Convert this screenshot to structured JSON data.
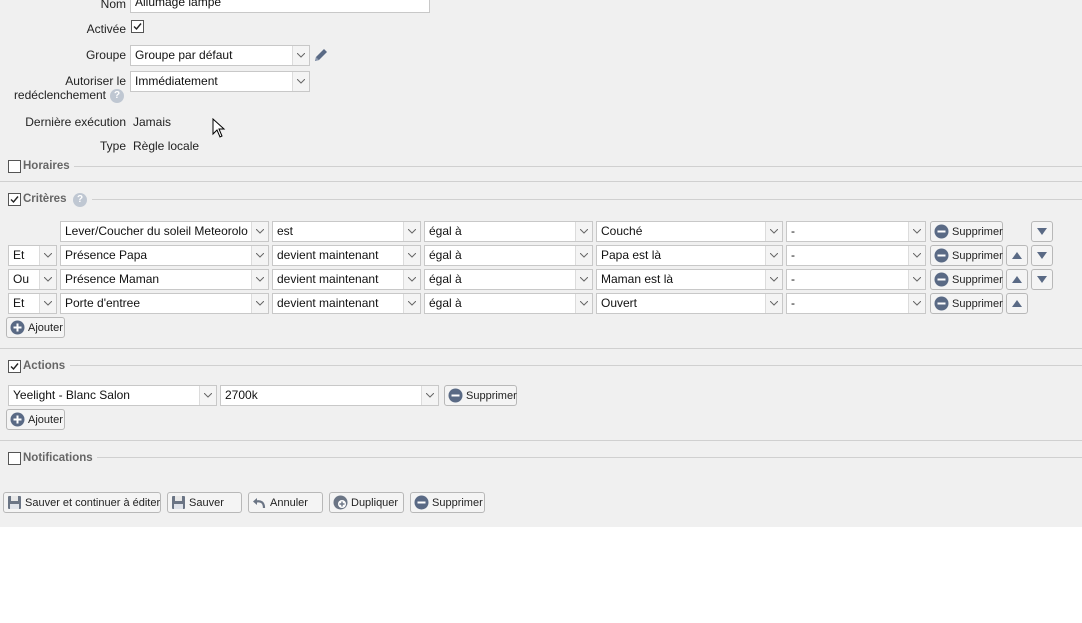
{
  "general": {
    "nom_label": "Nom",
    "nom_value": "Allumage lampe",
    "activee_label": "Activée",
    "groupe_label": "Groupe",
    "groupe_value": "Groupe par défaut",
    "autoriser_label_1": "Autoriser le",
    "autoriser_label_2": "redéclenchement",
    "autoriser_value": "Immédiatement",
    "derniere_label": "Dernière exécution",
    "derniere_value": "Jamais",
    "type_label": "Type",
    "type_value": "Règle locale"
  },
  "sections": {
    "horaires": "Horaires",
    "criteres": "Critères",
    "actions": "Actions",
    "notifications": "Notifications"
  },
  "criteria": {
    "rows": [
      {
        "conn": "",
        "subject": "Lever/Coucher du soleil Meteorolo",
        "verb": "est",
        "op": "égal à",
        "value": "Couché",
        "extra": "-",
        "delete": "Supprimer"
      },
      {
        "conn": "Et",
        "subject": "Présence Papa",
        "verb": "devient maintenant",
        "op": "égal à",
        "value": "Papa est là",
        "extra": "-",
        "delete": "Supprimer"
      },
      {
        "conn": "Ou",
        "subject": "Présence Maman",
        "verb": "devient maintenant",
        "op": "égal à",
        "value": "Maman est là",
        "extra": "-",
        "delete": "Supprimer"
      },
      {
        "conn": "Et",
        "subject": "Porte d'entree",
        "verb": "devient maintenant",
        "op": "égal à",
        "value": "Ouvert",
        "extra": "-",
        "delete": "Supprimer"
      }
    ],
    "add_label": "Ajouter"
  },
  "actions": {
    "device": "Yeelight - Blanc Salon",
    "value": "2700k",
    "delete_label": "Supprimer",
    "add_label": "Ajouter"
  },
  "footer": {
    "save_continue": "Sauver et continuer à éditer",
    "save": "Sauver",
    "cancel": "Annuler",
    "duplicate": "Dupliquer",
    "delete": "Supprimer"
  },
  "colors": {
    "panel_bg": "#f0f0f0",
    "icon_blue": "#5a6a85",
    "icon_gray": "#6b7585"
  }
}
